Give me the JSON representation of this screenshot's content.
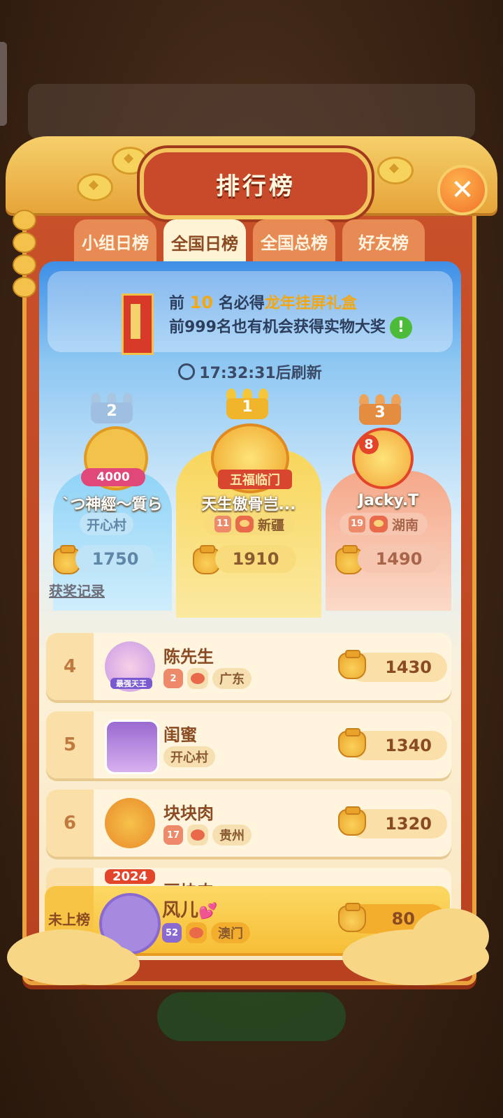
{
  "title": "排行榜",
  "close_icon": "✕",
  "tabs": [
    {
      "label": "小组日榜",
      "active": false
    },
    {
      "label": "全国日榜",
      "active": true
    },
    {
      "label": "全国总榜",
      "active": false
    },
    {
      "label": "好友榜",
      "active": false
    }
  ],
  "banner": {
    "line1_prefix": "前",
    "line1_number": "10",
    "line1_middle": "名必得",
    "line1_prize": "龙年挂屏礼盒",
    "line2": "前999名也有机会获得实物大奖",
    "info_icon": "!"
  },
  "refresh": "17:32:31后刷新",
  "podium": [
    {
      "rank": "2",
      "name": "`つ神經～質ら",
      "badge": "4000",
      "tags": [
        "开心村"
      ],
      "score": "1750"
    },
    {
      "rank": "1",
      "name": "天生傲骨岂...",
      "badge": "五福临门",
      "level": "11",
      "tags": [
        "新疆"
      ],
      "score": "1910"
    },
    {
      "rank": "3",
      "name": "Jacky.T",
      "badge": "8",
      "level": "19",
      "tags": [
        "湖南"
      ],
      "score": "1490"
    }
  ],
  "history_link": "获奖记录",
  "list": [
    {
      "rank": "4",
      "name": "陈先生",
      "level": "2",
      "region": "广东",
      "score": "1430",
      "frame_text": "最强天王"
    },
    {
      "rank": "5",
      "name": "闺蜜",
      "region": "开心村",
      "score": "1340"
    },
    {
      "rank": "6",
      "name": "块块肉",
      "level": "17",
      "region": "贵州",
      "score": "1320"
    },
    {
      "rank": "",
      "name": "豆块肉",
      "frame_text": "2024"
    }
  ],
  "me": {
    "rank": "未上榜",
    "name": "风儿",
    "name_emoji": "💕",
    "level": "52",
    "region": "澳门",
    "score": "80"
  }
}
